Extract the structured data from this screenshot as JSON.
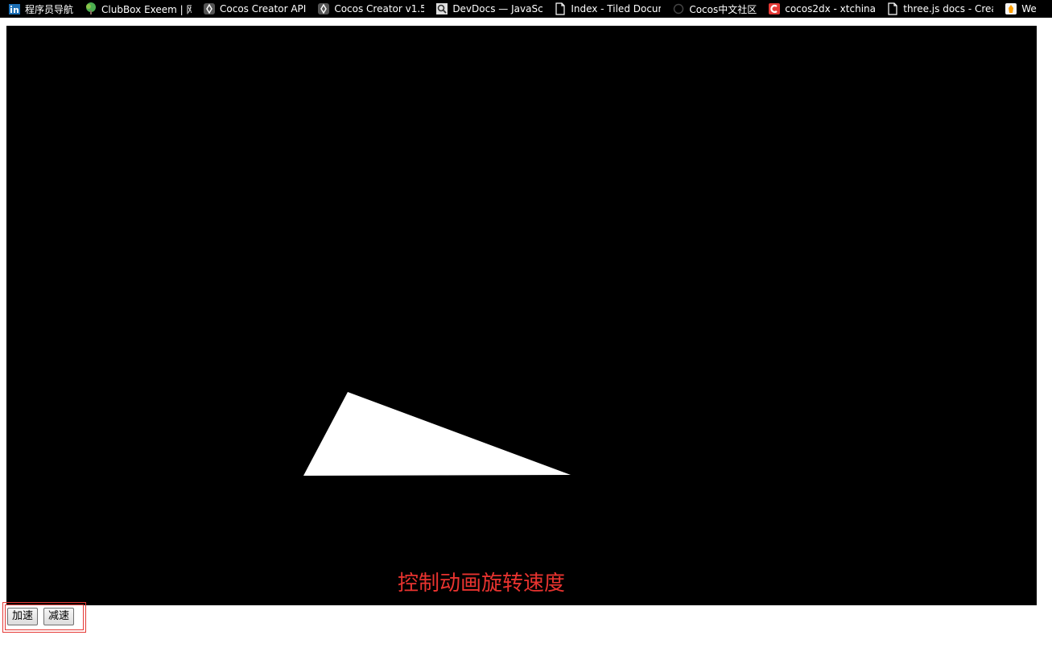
{
  "bookmarks": [
    {
      "icon": "linkedin-icon",
      "label": "程序员导航"
    },
    {
      "icon": "tree-icon",
      "label": "ClubBox Exeem | 网"
    },
    {
      "icon": "cocos-icon",
      "label": "Cocos Creator API"
    },
    {
      "icon": "cocos-icon",
      "label": "Cocos Creator v1.5"
    },
    {
      "icon": "devdocs-icon",
      "label": "DevDocs — JavaScr"
    },
    {
      "icon": "page-icon",
      "label": "Index - Tiled Docum"
    },
    {
      "icon": "chat-icon",
      "label": "Cocos中文社区"
    },
    {
      "icon": "cocos2dx-icon",
      "label": "cocos2dx - xtchina"
    },
    {
      "icon": "page-icon",
      "label": "three.js docs - Crea"
    },
    {
      "icon": "wp-icon",
      "label": "We"
    }
  ],
  "scene": {
    "shape": "triangle",
    "shape_color": "#ffffff",
    "background_color": "#000000"
  },
  "caption": "控制动画旋转速度",
  "caption_color": "#e8332f",
  "buttons": {
    "faster": "加速",
    "slower": "减速"
  }
}
